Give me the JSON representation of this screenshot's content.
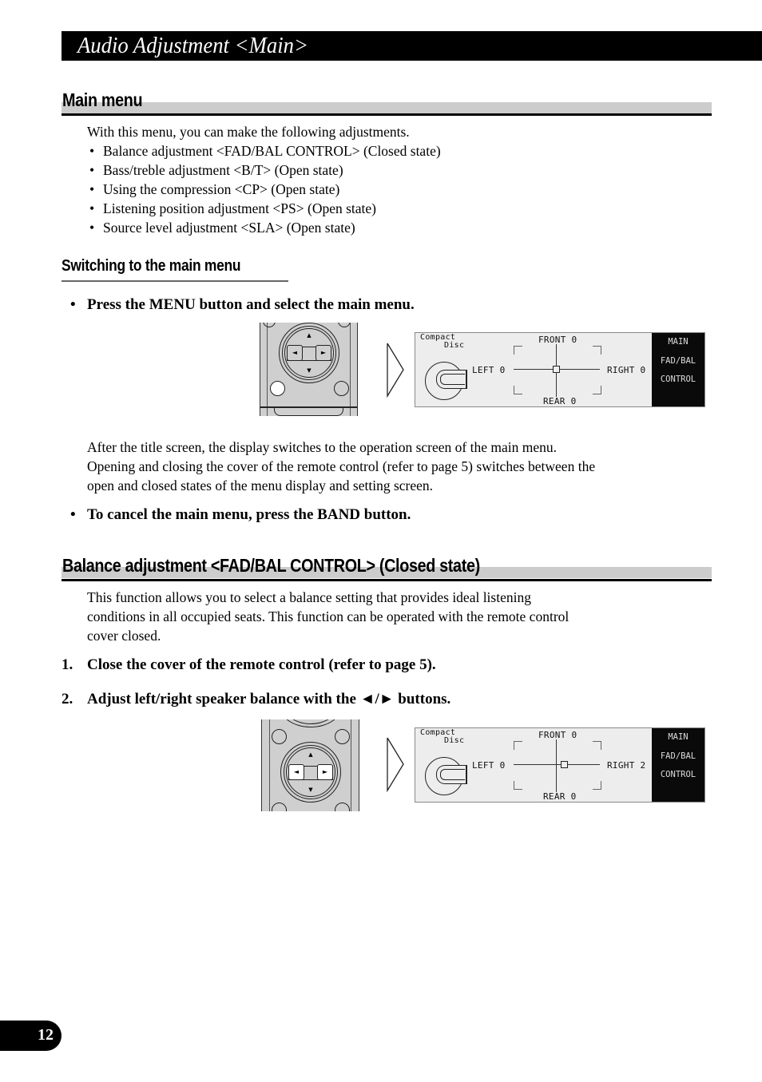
{
  "page": {
    "title": "Audio Adjustment <Main>",
    "page_number": "12"
  },
  "main_menu": {
    "heading": "Main menu",
    "intro": "With this menu, you can make the following adjustments.",
    "items": [
      "Balance adjustment <FAD/BAL CONTROL> (Closed state)",
      "Bass/treble adjustment <B/T> (Open state)",
      "Using the compression <CP> (Open state)",
      "Listening position adjustment <PS> (Open state)",
      "Source level adjustment <SLA> (Open state)"
    ]
  },
  "switching": {
    "heading": "Switching to the main menu",
    "bullet": "•",
    "instruction": "Press the MENU button and select the main menu.",
    "paragraph": [
      "After the title screen, the display switches to the operation screen of the main menu.",
      "Opening and closing the cover of the remote control (refer to page 5) switches between the",
      "open and closed states of the menu display and setting screen."
    ],
    "cancel_instruction": "To cancel the main menu, press the BAND button."
  },
  "balance": {
    "heading": "Balance adjustment <FAD/BAL CONTROL> (Closed state)",
    "paragraph": [
      "This function allows you to select a balance setting that provides ideal listening",
      "conditions in all occupied seats. This function can be operated with the remote control",
      "cover closed."
    ],
    "steps": [
      {
        "number": "1.",
        "text": "Close the cover of the remote control (refer to page 5)."
      },
      {
        "number": "2.",
        "text": "Adjust left/right speaker balance with the ◄/► buttons."
      }
    ]
  },
  "remote": {
    "up_arrow": "▲",
    "down_arrow": "▼",
    "left_arrow": "◄",
    "right_arrow": "►"
  },
  "displays": [
    {
      "source_line1": "Compact",
      "source_line2": "Disc",
      "front": "FRONT 0",
      "rear": "REAR 0",
      "left": "LEFT 0",
      "right": "RIGHT 0",
      "menu_title": "MAIN",
      "menu_line2": "FAD/BAL",
      "menu_line3": "CONTROL",
      "balance_value": 0
    },
    {
      "source_line1": "Compact",
      "source_line2": "Disc",
      "front": "FRONT 0",
      "rear": "REAR 0",
      "left": "LEFT 0",
      "right": "RIGHT 2",
      "menu_title": "MAIN",
      "menu_line2": "FAD/BAL",
      "menu_line3": "CONTROL",
      "balance_value": 2
    }
  ]
}
